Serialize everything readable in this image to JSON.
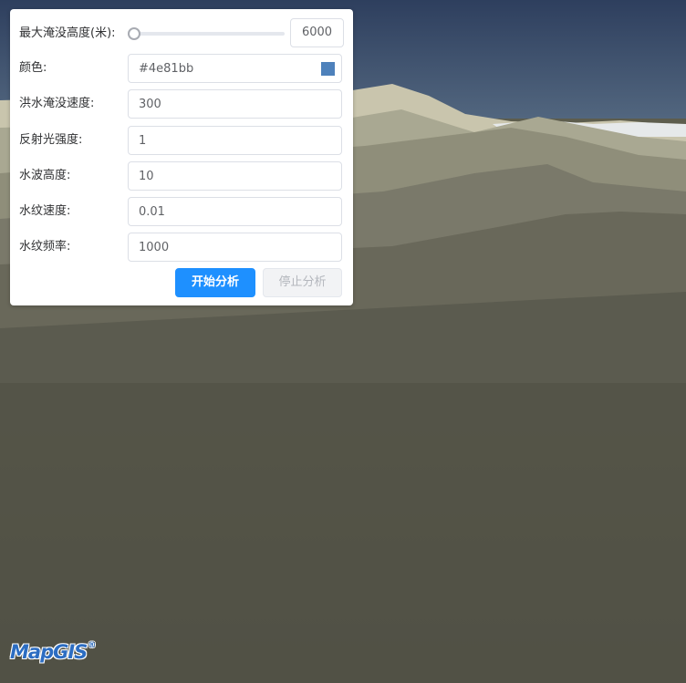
{
  "panel": {
    "max_height": {
      "label": "最大淹没高度(米):",
      "value": "6000"
    },
    "color": {
      "label": "颜色:",
      "value": "#4e81bb",
      "swatch_color": "#4e81bb"
    },
    "flood_speed": {
      "label": "洪水淹没速度:",
      "value": "300"
    },
    "reflect_intensity": {
      "label": "反射光强度:",
      "value": "1"
    },
    "wave_height": {
      "label": "水波高度:",
      "value": "10"
    },
    "ripple_speed": {
      "label": "水纹速度:",
      "value": "0.01"
    },
    "ripple_freq": {
      "label": "水纹频率:",
      "value": "1000"
    },
    "start_button": "开始分析",
    "stop_button": "停止分析"
  },
  "logo": {
    "text": "MapGIS",
    "reg": "®"
  }
}
